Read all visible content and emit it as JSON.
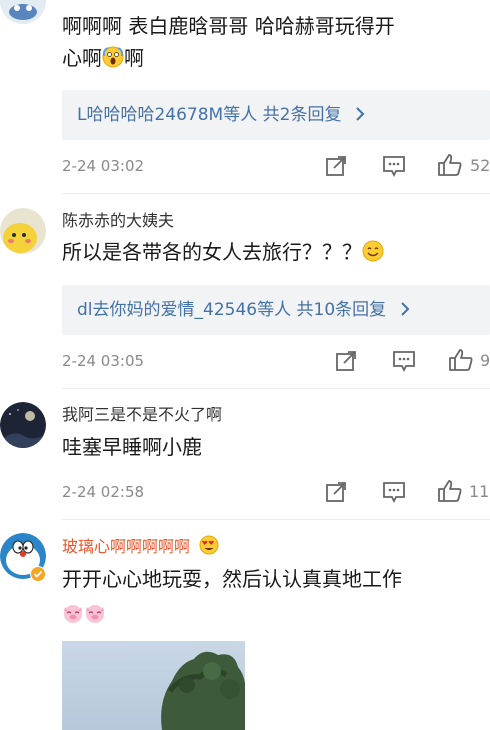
{
  "comments": [
    {
      "text_line1": "啊啊啊    表白鹿晗哥哥   哈哈赫哥玩得开",
      "text_line2_prefix": "心啊",
      "text_line2_suffix": "啊",
      "emoji": "scream-emoji",
      "reply_user": "L哈哈哈哈24678M",
      "reply_suffix": "等人  共2条回复",
      "time": "2-24 03:02",
      "likes": "52"
    },
    {
      "username": "陈赤赤的大姨夫",
      "text": "所以是各带各的女人去旅行？？？",
      "emoji": "smile-emoji",
      "reply_user": "dl去你妈的爱情_42546",
      "reply_suffix": "等人  共10条回复",
      "time": "2-24 03:05",
      "likes": "9"
    },
    {
      "username": "我阿三是不是不火了啊",
      "text": "哇塞早睡啊小鹿",
      "time": "2-24 02:58",
      "likes": "11"
    },
    {
      "username": "玻璃心啊啊啊啊啊",
      "badge_emoji": "heart-eyes-emoji",
      "text": "开开心心地玩耍，然后认认真真地工作",
      "emoji_line": "pig-emoji pig-emoji"
    }
  ],
  "icons": [
    "share-icon",
    "comment-icon",
    "like-icon",
    "chevron-right-icon",
    "verified-icon"
  ],
  "colors": {
    "link": "#4472a8",
    "vip_name": "#e8562a",
    "meta": "#8a8a8a",
    "reply_bg": "#f2f3f5"
  }
}
